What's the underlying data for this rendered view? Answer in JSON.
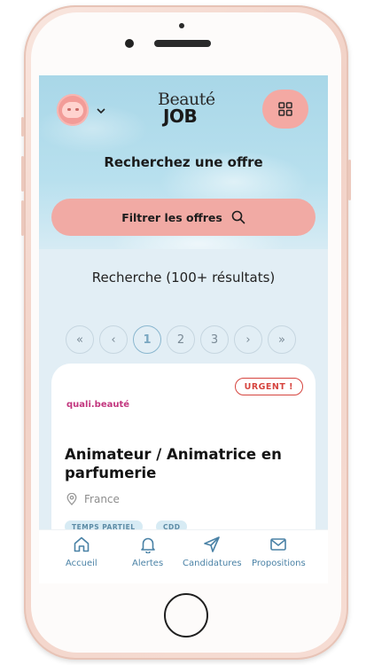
{
  "header": {
    "logo_top": "Beauté",
    "logo_bottom": "JOB",
    "avatar_icon": "avatar-face",
    "menu_icon": "grid-icon"
  },
  "hero": {
    "title": "Recherchez une offre",
    "filter_label": "Filtrer les offres"
  },
  "results_label": "Recherche (100+ résultats)",
  "pagination": {
    "first": "«",
    "prev": "‹",
    "pages": [
      "1",
      "2",
      "3"
    ],
    "active_page": "1",
    "next": "›",
    "last": "»"
  },
  "job_card": {
    "badge": "URGENT !",
    "company": "quali.beauté",
    "title": "Animateur / Animatrice en parfumerie",
    "location": "France",
    "tags": [
      "TEMPS PARTIEL",
      "CDD"
    ]
  },
  "tabbar": {
    "items": [
      {
        "label": "Accueil",
        "icon": "home-icon"
      },
      {
        "label": "Alertes",
        "icon": "bell-icon"
      },
      {
        "label": "Candidatures",
        "icon": "send-icon"
      },
      {
        "label": "Propositions",
        "icon": "mail-icon"
      }
    ]
  },
  "colors": {
    "accent_pink": "#f1aaa4",
    "urgent_red": "#d6453f",
    "brand_magenta": "#c2367e",
    "tab_blue": "#4a82a6"
  }
}
